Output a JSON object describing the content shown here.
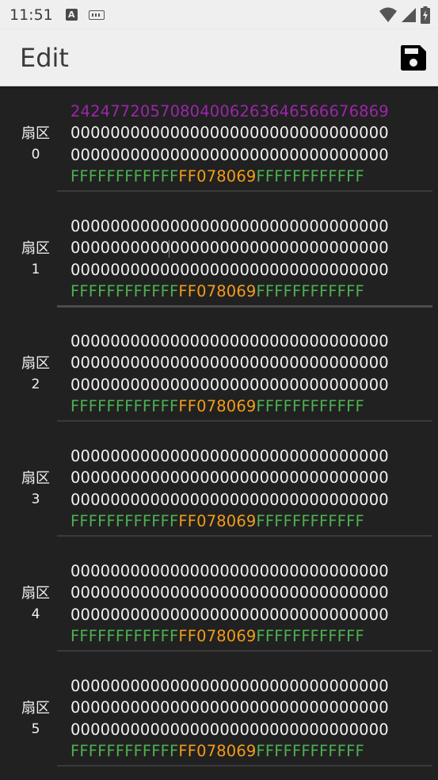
{
  "status_bar": {
    "time": "11:51",
    "icons": [
      "text-input-icon",
      "keyboard-icon",
      "wifi-icon",
      "signal-icon",
      "battery-charging-icon"
    ]
  },
  "app_bar": {
    "title": "Edit",
    "save_icon": "save-icon"
  },
  "colors": {
    "uid": "#9b27a8",
    "key": "#4caf50",
    "access": "#f39c18",
    "data": "#f2f2f2",
    "background": "#212121",
    "app_bar": "#efefef"
  },
  "sectors": [
    {
      "label": "扇区",
      "number": "0",
      "blocks": [
        "24247720570804006263646566676869",
        "00000000000000000000000000000000",
        "00000000000000000000000000000000"
      ],
      "trailer": {
        "key_a": "FFFFFFFFFFFF",
        "access": "FF078069",
        "key_b": "FFFFFFFFFFFF"
      }
    },
    {
      "label": "扇区",
      "number": "1",
      "blocks": [
        "00000000000000000000000000000000",
        "00000000000000000000000000000000",
        "00000000000000000000000000000000"
      ],
      "trailer": {
        "key_a": "FFFFFFFFFFFF",
        "access": "FF078069",
        "key_b": "FFFFFFFFFFFF"
      }
    },
    {
      "label": "扇区",
      "number": "2",
      "blocks": [
        "00000000000000000000000000000000",
        "00000000000000000000000000000000",
        "00000000000000000000000000000000"
      ],
      "trailer": {
        "key_a": "FFFFFFFFFFFF",
        "access": "FF078069",
        "key_b": "FFFFFFFFFFFF"
      }
    },
    {
      "label": "扇区",
      "number": "3",
      "blocks": [
        "00000000000000000000000000000000",
        "00000000000000000000000000000000",
        "00000000000000000000000000000000"
      ],
      "trailer": {
        "key_a": "FFFFFFFFFFFF",
        "access": "FF078069",
        "key_b": "FFFFFFFFFFFF"
      }
    },
    {
      "label": "扇区",
      "number": "4",
      "blocks": [
        "00000000000000000000000000000000",
        "00000000000000000000000000000000",
        "00000000000000000000000000000000"
      ],
      "trailer": {
        "key_a": "FFFFFFFFFFFF",
        "access": "FF078069",
        "key_b": "FFFFFFFFFFFF"
      }
    },
    {
      "label": "扇区",
      "number": "5",
      "blocks": [
        "00000000000000000000000000000000",
        "00000000000000000000000000000000",
        "00000000000000000000000000000000"
      ],
      "trailer": {
        "key_a": "FFFFFFFFFFFF",
        "access": "FF078069",
        "key_b": "FFFFFFFFFFFF"
      }
    }
  ]
}
